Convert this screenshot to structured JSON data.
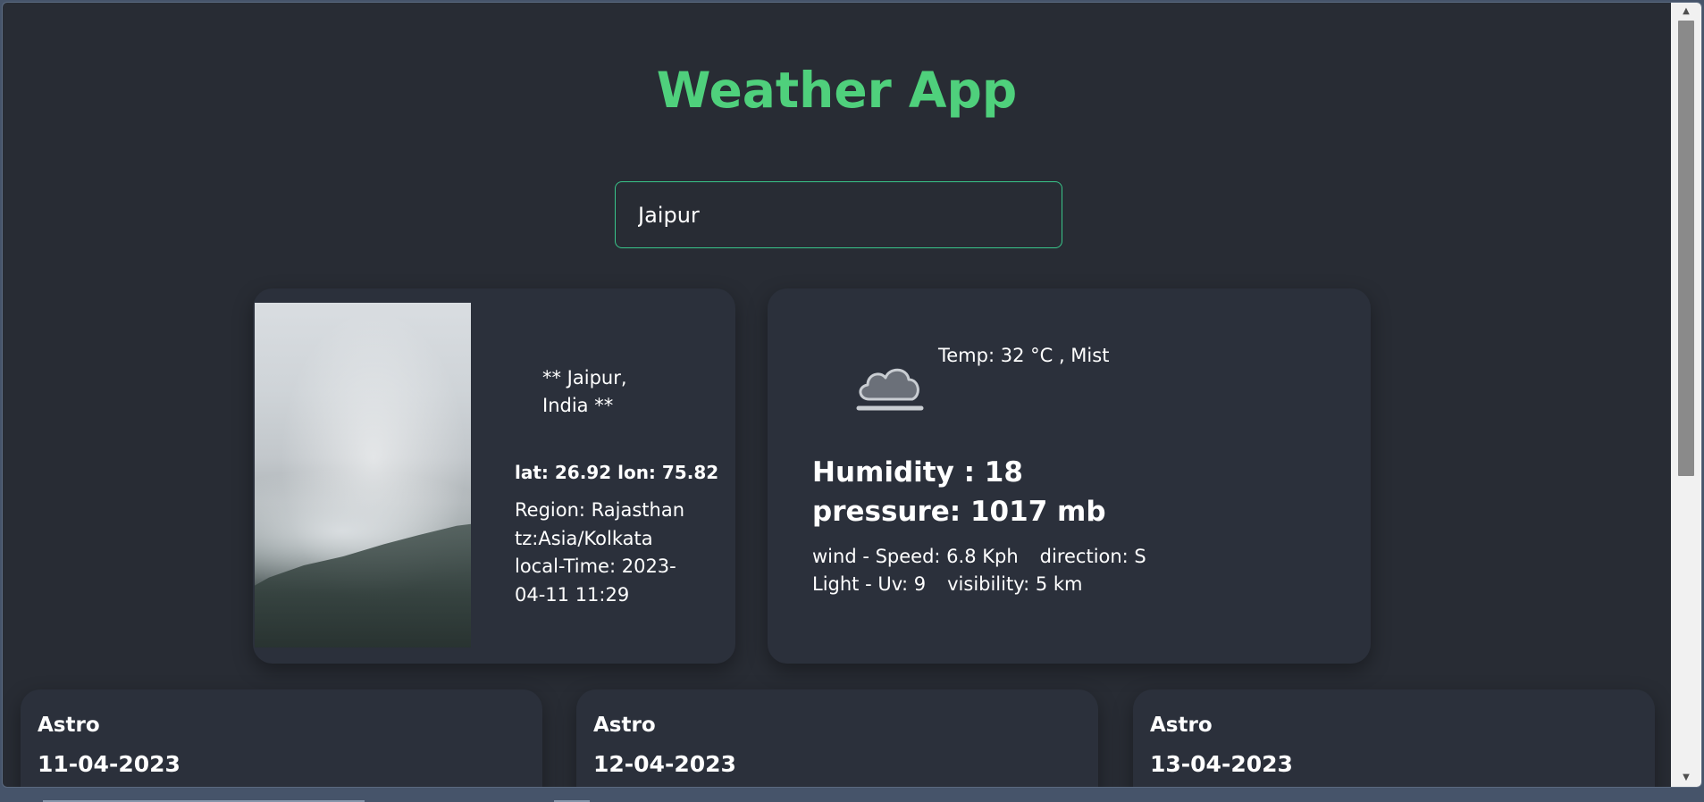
{
  "app": {
    "title": "Weather App"
  },
  "search": {
    "value": "Jaipur",
    "placeholder": ""
  },
  "location": {
    "name": "** Jaipur, India **",
    "coords": "lat: 26.92 lon: 75.82",
    "region": "Region: Rajasthan",
    "tz": "tz:Asia/Kolkata",
    "local_time": "local-Time: 2023-04-11 11:29",
    "photo_icon": "misty-mountain-photo"
  },
  "weather": {
    "icon": "mist-cloud-icon",
    "temp_line": "Temp: 32 °C , Mist",
    "humidity": "Humidity : 18",
    "pressure": "pressure: 1017 mb",
    "wind_speed": "wind - Speed: 6.8 Kph",
    "wind_direction": "direction: S",
    "light_uv": "Light - Uv: 9",
    "visibility": "visibility: 5 km"
  },
  "astro": [
    {
      "title": "Astro",
      "date": "11-04-2023"
    },
    {
      "title": "Astro",
      "date": "12-04-2023"
    },
    {
      "title": "Astro",
      "date": "13-04-2023"
    }
  ],
  "colors": {
    "background": "#282c34",
    "card": "#2b303b",
    "accent_title": "#4fd07c",
    "search_border": "#39c68a",
    "text": "#ffffff"
  }
}
